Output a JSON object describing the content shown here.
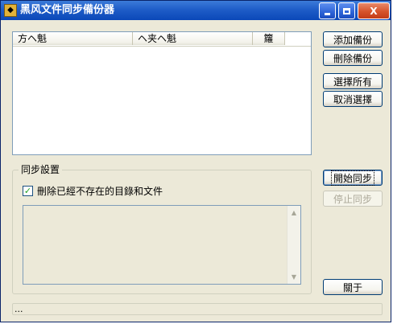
{
  "window": {
    "title": "黑风文件同步備份器",
    "app_icon": "app-icon",
    "buttons": {
      "minimize_icon": "minimize-icon",
      "maximize_icon": "maximize-icon",
      "close_icon": "close-icon",
      "close_glyph": "X"
    }
  },
  "file_list": {
    "columns": [
      "方ヘ魁",
      "ヘ夹ヘ魁",
      "籮"
    ]
  },
  "side_buttons": {
    "add": "添加備份",
    "delete": "刪除備份",
    "select_all": "選擇所有",
    "cancel_select": "取消選擇",
    "start_sync": "開始同步",
    "stop_sync": "停止同步",
    "about": "關于"
  },
  "sync_settings": {
    "group_title": "同步設置",
    "delete_missing_label": "刪除已經不存在的目錄和文件",
    "delete_missing_checked": true,
    "check_glyph": "✓"
  },
  "log": {
    "scroll_up": "▲",
    "scroll_down": "▼"
  },
  "status_bar": {
    "text": "..."
  }
}
